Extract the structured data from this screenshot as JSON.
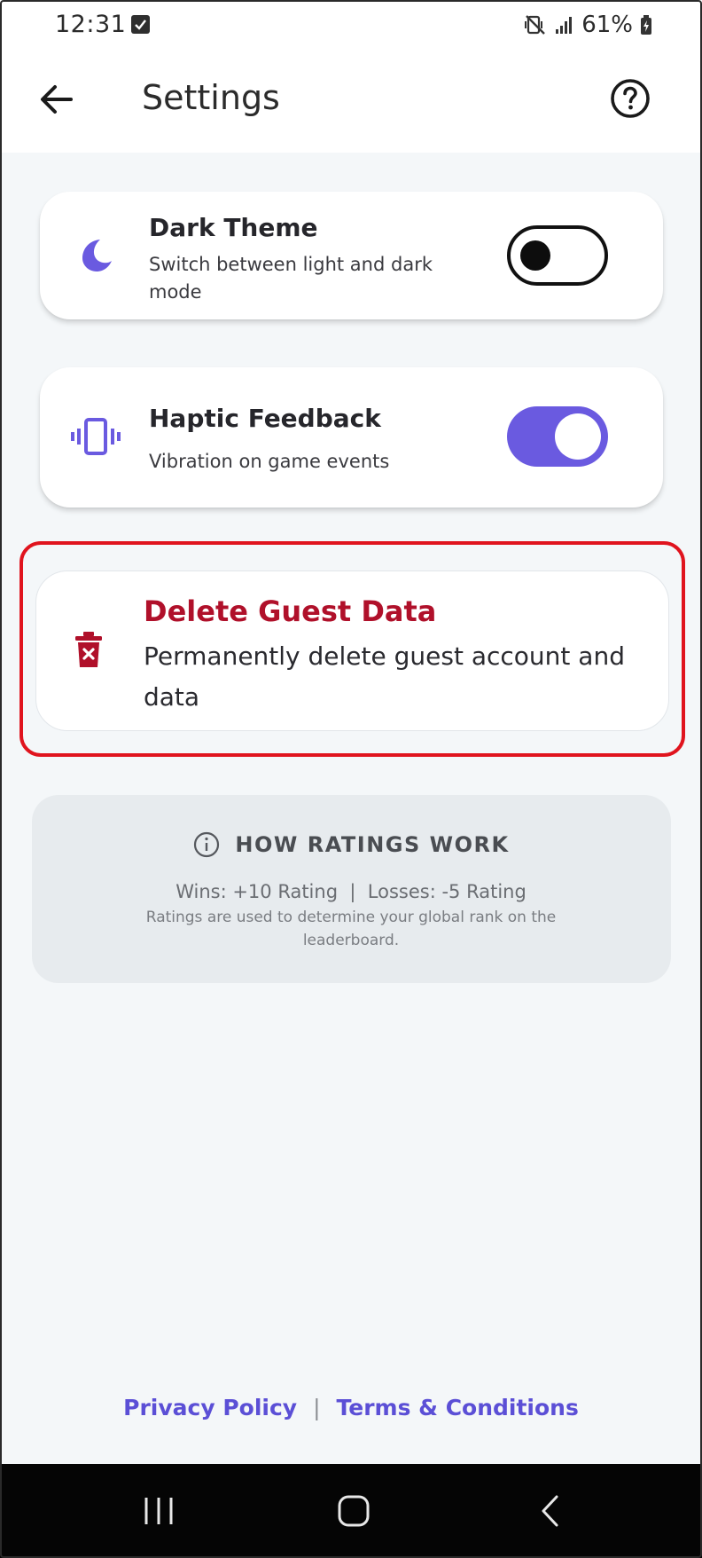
{
  "status_bar": {
    "time": "12:31",
    "battery": "61%",
    "icons": [
      "checkbox-notification-icon",
      "mute-vibrate-icon",
      "signal-icon",
      "battery-icon"
    ]
  },
  "header": {
    "title": "Settings",
    "back_icon": "arrow-left-icon",
    "help_icon": "help-circle-icon"
  },
  "settings": {
    "dark_theme": {
      "title": "Dark Theme",
      "subtitle": "Switch between light and dark mode",
      "icon": "moon-icon",
      "enabled": false
    },
    "haptic": {
      "title": "Haptic Feedback",
      "subtitle": "Vibration on game events",
      "icon": "vibration-icon",
      "enabled": true
    },
    "delete_guest": {
      "title": "Delete Guest Data",
      "subtitle": "Permanently delete guest account and data",
      "icon": "trash-icon"
    }
  },
  "ratings_info": {
    "heading": "HOW RATINGS WORK",
    "icon": "info-icon",
    "rule": "Wins: +10 Rating  |  Losses: -5 Rating",
    "note": "Ratings are used to determine your global rank on the leaderboard."
  },
  "footer": {
    "privacy": "Privacy Policy",
    "separator": "|",
    "terms": "Terms & Conditions"
  },
  "colors": {
    "accent": "#6a5ae0",
    "danger": "#b0102a",
    "highlight_outline": "#e0141e",
    "background": "#f4f7f9"
  }
}
